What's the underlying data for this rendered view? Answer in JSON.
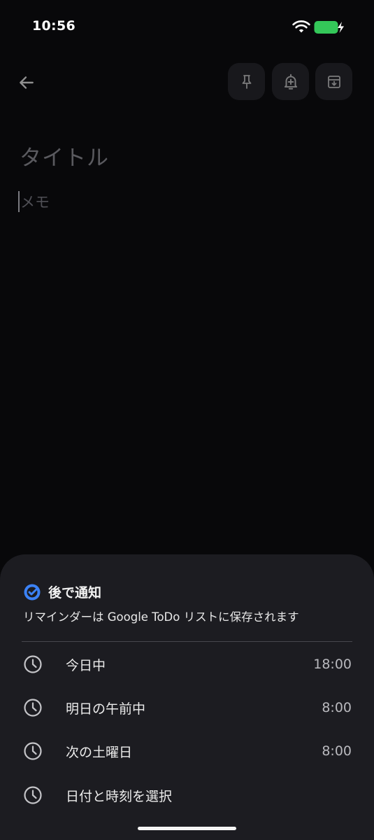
{
  "status_bar": {
    "time": "10:56",
    "wifi_icon": "wifi-icon",
    "battery_icon": "battery-charging-icon",
    "battery_color": "#34c759"
  },
  "app_bar": {
    "back_icon": "arrow-left-icon",
    "actions": [
      {
        "name": "pin",
        "icon": "pin-icon"
      },
      {
        "name": "reminder",
        "icon": "bell-plus-icon"
      },
      {
        "name": "archive",
        "icon": "archive-icon"
      }
    ]
  },
  "note": {
    "title_placeholder": "タイトル",
    "body_placeholder": "メモ"
  },
  "reminder_sheet": {
    "icon": "check-badge-icon",
    "accent_color": "#3b82f6",
    "title": "後で通知",
    "subtitle": "リマインダーは Google ToDo リストに保存されます",
    "options": [
      {
        "label": "今日中",
        "time": "18:00",
        "icon": "clock-icon"
      },
      {
        "label": "明日の午前中",
        "time": "8:00",
        "icon": "clock-icon"
      },
      {
        "label": "次の土曜日",
        "time": "8:00",
        "icon": "clock-icon"
      },
      {
        "label": "日付と時刻を選択",
        "time": "",
        "icon": "clock-icon"
      }
    ]
  }
}
